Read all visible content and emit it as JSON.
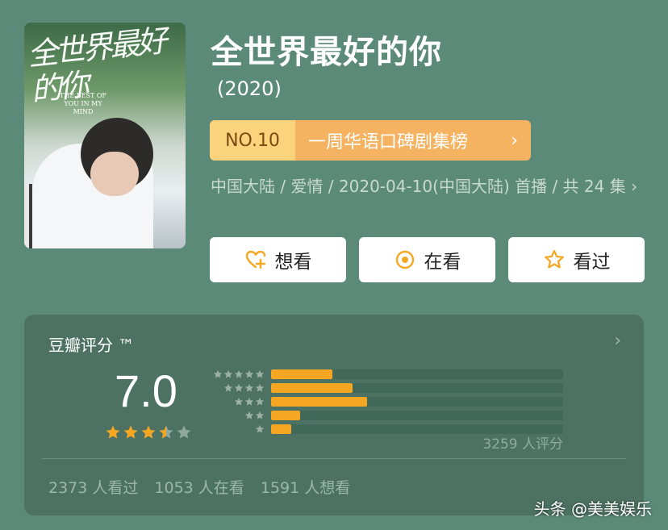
{
  "poster": {
    "calligraphy": "全世界最好的你",
    "english": "THE BEST OF YOU IN MY MIND"
  },
  "title": "全世界最好的你",
  "year": "(2020)",
  "rank": {
    "no": "NO.10",
    "list": "一周华语口碑剧集榜",
    "chevron": "›"
  },
  "meta": "中国大陆 / 爱情 / 2020-04-10(中国大陆) 首播 / 共 24 集",
  "meta_chevron": "›",
  "buttons": {
    "want": "想看",
    "watching": "在看",
    "watched": "看过"
  },
  "rating": {
    "heading": "豆瓣评分 ™",
    "score": "7.0",
    "stars_value": 3.5,
    "stars_max": 5,
    "distribution": [
      {
        "stars": 5,
        "fraction": 0.21
      },
      {
        "stars": 4,
        "fraction": 0.28
      },
      {
        "stars": 3,
        "fraction": 0.33
      },
      {
        "stars": 2,
        "fraction": 0.1
      },
      {
        "stars": 1,
        "fraction": 0.07
      }
    ],
    "count": "3259 人评分",
    "watched": "2373 人看过",
    "watching": "1053 人在看",
    "want": "1591 人想看"
  },
  "watermark": "头条 @美美娱乐",
  "colors": {
    "background": "#5c8a79",
    "card": "#4d7263",
    "star": "#f5a623",
    "rank_no_bg": "#fbd37c",
    "rank_list_bg": "#f5b361"
  }
}
